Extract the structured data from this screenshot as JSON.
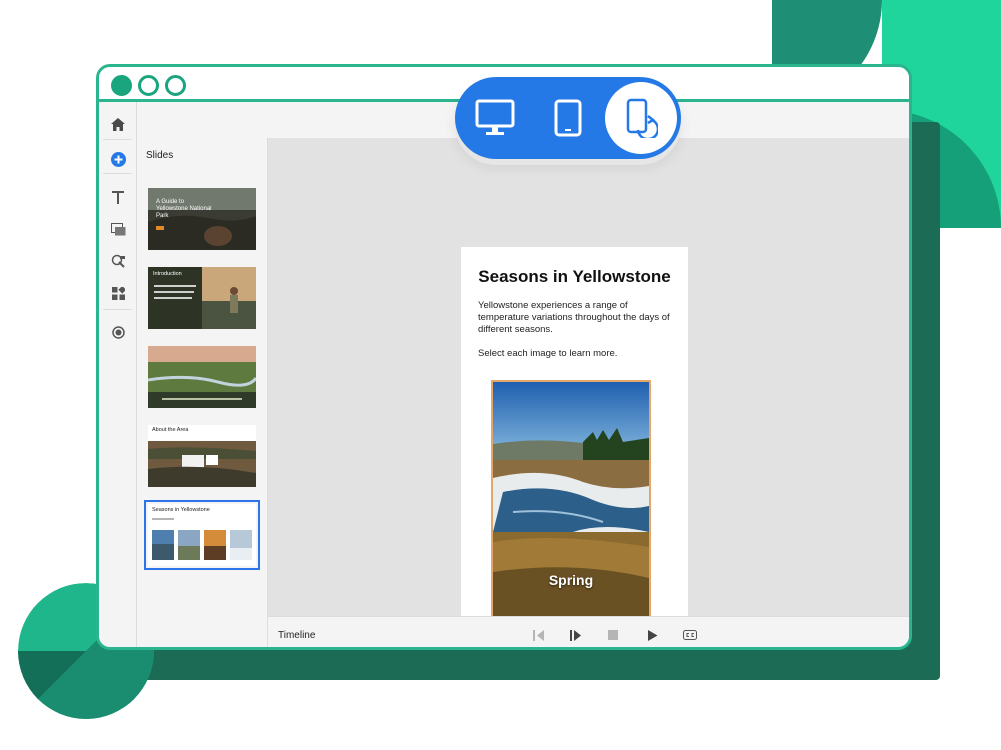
{
  "panel": {
    "slides_title": "Slides"
  },
  "slide": {
    "title": "Seasons in Yellowstone",
    "description": "Yellowstone experiences a range of temperature variations throughout the days of different seasons.",
    "instruction": "Select each image to learn more.",
    "card_label": "Spring"
  },
  "thumbnails": [
    {
      "name": "slide-1",
      "caption": "A Guide to Yellowstone National Park"
    },
    {
      "name": "slide-2",
      "caption": "Introduction"
    },
    {
      "name": "slide-3",
      "caption": ""
    },
    {
      "name": "slide-4",
      "caption": "About the Area"
    },
    {
      "name": "slide-5",
      "caption": "Seasons in Yellowstone",
      "selected": true
    }
  ],
  "timeline": {
    "label": "Timeline"
  },
  "device_switcher": {
    "active": "mobile"
  },
  "colors": {
    "accent_green": "#2bb58f",
    "accent_blue": "#2479e6",
    "card_border": "#e4a66a",
    "selected_thumb": "#2d74e8"
  },
  "icons": {
    "rail": [
      "home-icon",
      "add-icon",
      "text-icon",
      "media-icon",
      "interaction-icon",
      "widgets-icon",
      "record-icon"
    ],
    "timeline": [
      "rewind-icon",
      "play-pause-icon",
      "stop-icon",
      "play-icon",
      "closed-caption-icon"
    ],
    "devices": [
      "desktop-icon",
      "tablet-icon",
      "mobile-icon"
    ]
  }
}
